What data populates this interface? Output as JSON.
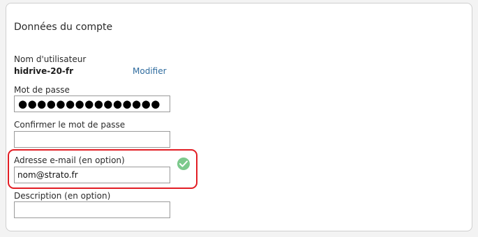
{
  "account": {
    "title": "Données du compte",
    "username_label": "Nom d'utilisateur",
    "username_value": "hidrive-20-fr",
    "modify_link": "Modifier",
    "password_label": "Mot de passe",
    "password_mask": "●●●●●●●●●●●●●●●",
    "confirm_password_label": "Confirmer le mot de passe",
    "confirm_password_value": "",
    "email_label": "Adresse e-mail (en option)",
    "email_value": "nom@strato.fr",
    "description_label": "Description (en option)",
    "description_value": ""
  },
  "colors": {
    "highlight": "#e21d24",
    "valid": "#7cc98c",
    "link": "#2e6b9e"
  },
  "icons": {
    "email_status": "check-circle-icon"
  }
}
